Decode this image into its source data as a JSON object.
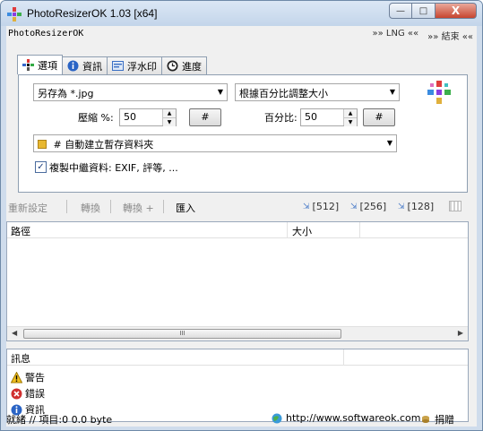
{
  "window": {
    "title": "PhotoResizerOK 1.03 [x64]",
    "min_glyph": "—",
    "max_glyph": "□",
    "close_glyph": "X"
  },
  "menubar": {
    "app_name": "PhotoResizerOK",
    "lng_label": "»» LNG ««",
    "exit_label": "»» 結束 ««"
  },
  "tabs": [
    {
      "label": "選項",
      "icon": "settings-icon"
    },
    {
      "label": "資訊",
      "icon": "info-icon"
    },
    {
      "label": "浮水印",
      "icon": "watermark-icon"
    },
    {
      "label": "進度",
      "icon": "clock-icon"
    }
  ],
  "options": {
    "save_as": "另存為 *.jpg",
    "resize_mode": "根據百分比調整大小",
    "compress_label": "壓縮 %:",
    "compress_value": "50",
    "hash_button": "#",
    "percent_label": "百分比:",
    "percent_value": "50",
    "folder_value": "# 自動建立暫存資料夾",
    "copy_meta_label": "複製中繼資料: EXIF, 評等, ...",
    "copy_meta_checked": true
  },
  "toolbar": {
    "reset": "重新設定",
    "convert": "轉換",
    "convert_plus": "轉換 +",
    "import": "匯入",
    "size_512": "[512]",
    "size_256": "[256]",
    "size_128": "[128]"
  },
  "list": {
    "col_path": "路徑",
    "col_size": "大小",
    "scroll_thumb": "III"
  },
  "messages": {
    "header": "訊息",
    "items": [
      {
        "label": "警告",
        "icon": "warning-icon",
        "color": "#e0a000"
      },
      {
        "label": "錯誤",
        "icon": "error-icon",
        "color": "#d03030"
      },
      {
        "label": "資訊",
        "icon": "info-icon",
        "color": "#2a64c5"
      }
    ]
  },
  "status": {
    "left": "就緒 // 項目:0 0.0 byte",
    "url": "http://www.softwareok.com",
    "donate": "捐贈"
  }
}
